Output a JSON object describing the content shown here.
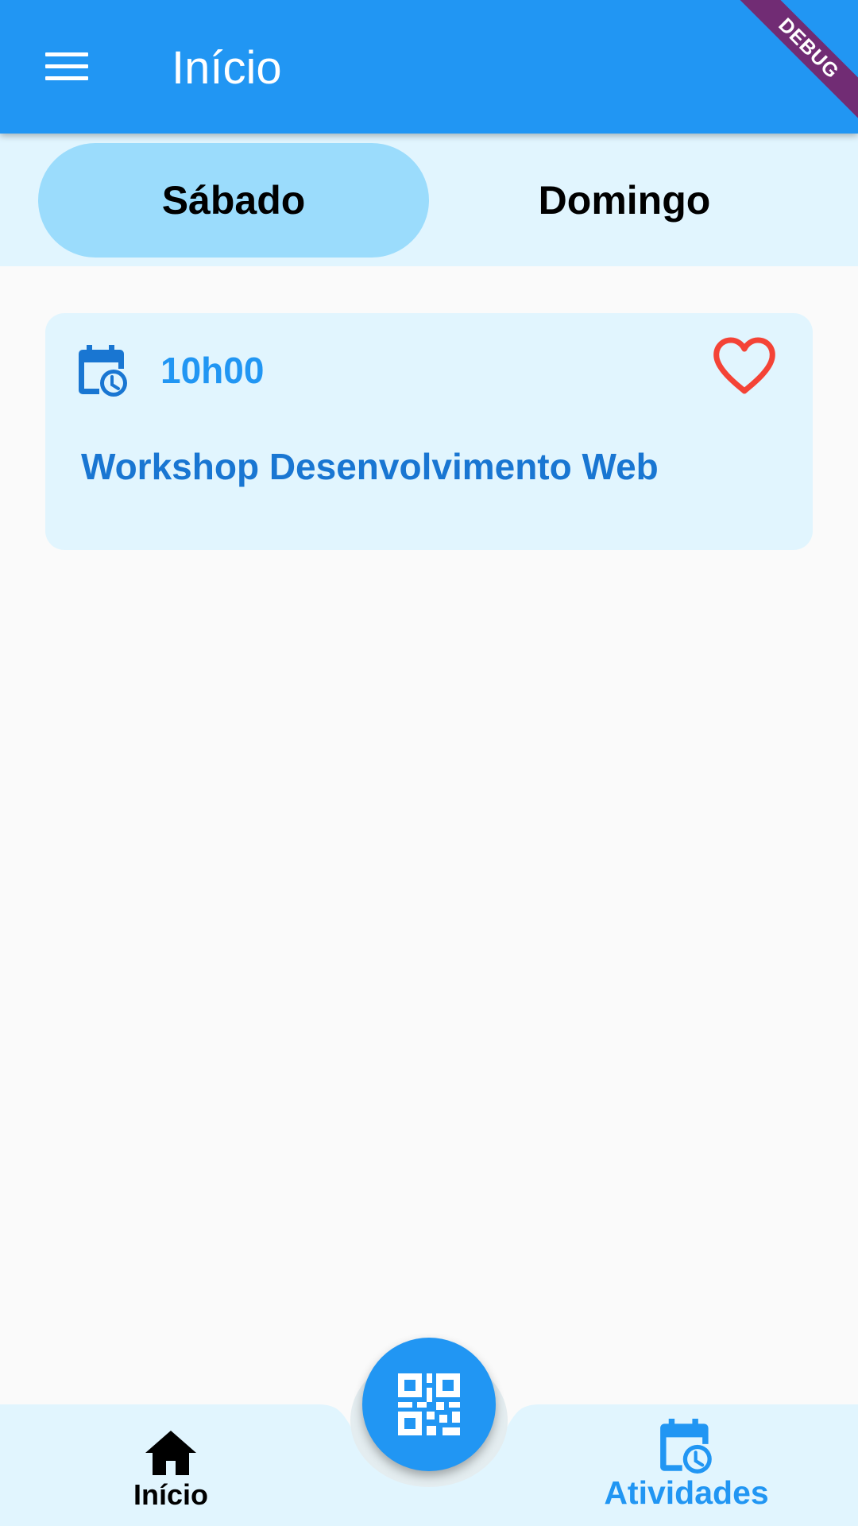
{
  "app_bar": {
    "title": "Início",
    "menu_icon": "menu-icon",
    "debug_banner": "DEBUG"
  },
  "tabs": [
    {
      "label": "Sábado",
      "selected": true
    },
    {
      "label": "Domingo",
      "selected": false
    }
  ],
  "events": [
    {
      "time": "10h00",
      "title": "Workshop Desenvolvimento Web",
      "icon": "calendar-clock-icon",
      "favorite_icon": "heart-outline-icon"
    }
  ],
  "bottom_nav": {
    "items": [
      {
        "label": "Início",
        "icon": "home-icon"
      },
      {
        "label": "Atividades",
        "icon": "calendar-clock-icon"
      }
    ],
    "fab_icon": "qr-code-icon"
  },
  "colors": {
    "primary": "#2196F3",
    "primary_dark": "#1976D2",
    "light_background": "#E1F5FE",
    "tab_selected": "#9BDCFC",
    "heart": "#F44336",
    "page_background": "#FAFAFA"
  }
}
